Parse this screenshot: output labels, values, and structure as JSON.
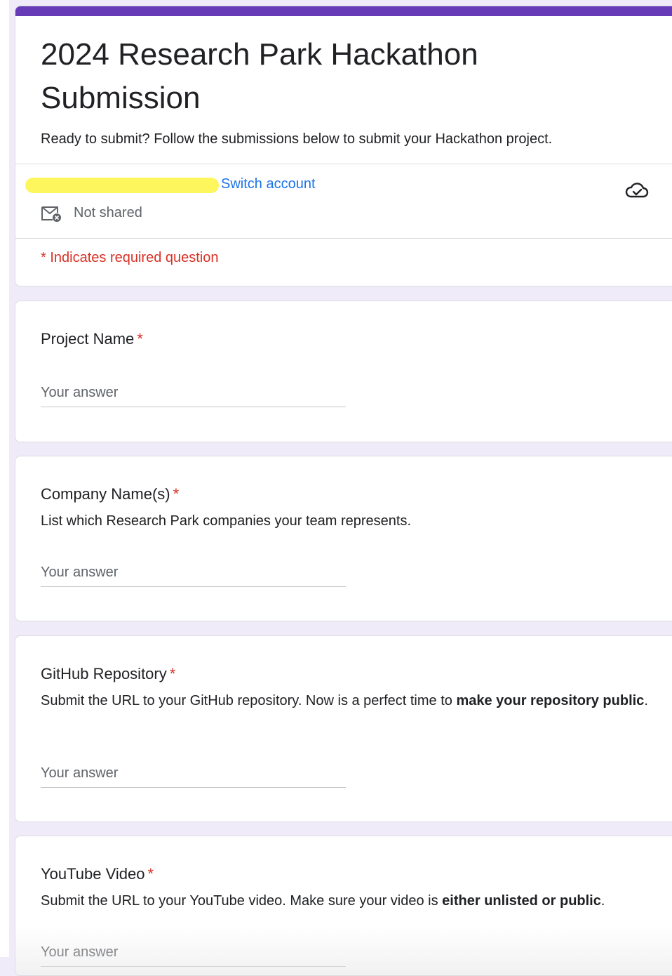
{
  "colors": {
    "accent": "#673ab7",
    "page_bg": "#f0ebf8",
    "link": "#1a73e8",
    "required": "#d93025"
  },
  "form": {
    "title": "2024 Research Park Hackathon Submission",
    "description": "Ready to submit? Follow the submissions below to submit your Hackathon project."
  },
  "account": {
    "switch_label": "Switch account",
    "not_shared_label": "Not shared",
    "sync_icon": "cloud-check-icon",
    "mail_icon": "mail-off-icon"
  },
  "required_note": "* Indicates required question",
  "questions": [
    {
      "title": "Project Name",
      "required_mark": "*",
      "placeholder": "Your answer"
    },
    {
      "title": "Company Name(s)",
      "required_mark": "*",
      "description": "List which Research Park companies your team represents.",
      "placeholder": "Your answer"
    },
    {
      "title": "GitHub Repository",
      "required_mark": "*",
      "description_plain": "Submit the URL to your GitHub repository. Now is a perfect time to ",
      "description_bold": "make your repository public",
      "description_end": ".",
      "placeholder": "Your answer"
    },
    {
      "title": "YouTube Video",
      "required_mark": "*",
      "description_plain": "Submit the URL to your YouTube video. Make sure your video is ",
      "description_bold": "either unlisted or public",
      "description_end": ".",
      "placeholder": "Your answer"
    }
  ]
}
